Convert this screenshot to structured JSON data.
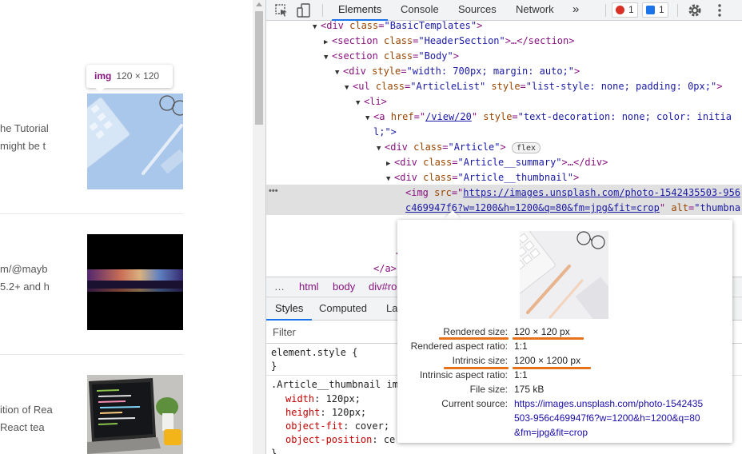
{
  "page": {
    "articles": [
      {
        "snippet_line1": "he Tutorial",
        "snippet_line2": " might be t"
      },
      {
        "snippet_line1": "m/@mayb",
        "snippet_line2": "5.2+ and h"
      },
      {
        "snippet_line1": "ition of Rea",
        "snippet_line2": " React tea"
      }
    ],
    "tooltip": {
      "tag": "img",
      "size": "120 × 120"
    }
  },
  "devtools": {
    "tabs": [
      {
        "label": "Elements",
        "active": true
      },
      {
        "label": "Console"
      },
      {
        "label": "Sources"
      },
      {
        "label": "Network"
      }
    ],
    "more_tabs": "»",
    "errors_count": "1",
    "messages_count": "1",
    "dom": {
      "l1_tag": "<div ",
      "l1_attr": "class",
      "l1_val": "\"BasicTemplates\"",
      "l1_end": ">",
      "l2_tag": "<section ",
      "l2_attr": "class",
      "l2_val": "\"HeaderSection\"",
      "l2_end": ">…</section>",
      "l3_tag": "<section ",
      "l3_attr": "class",
      "l3_val": "\"Body\"",
      "l3_end": ">",
      "l4_tag": "<div ",
      "l4_attr": "style",
      "l4_val": "\"width: 700px; margin: auto;\"",
      "l4_end": ">",
      "l5_tag": "<ul ",
      "l5_attr": "class",
      "l5_val": "\"ArticleList\"",
      "l5_attr2": "style",
      "l5_val2": "\"list-style: none; padding: 0px;\"",
      "l5_end": ">",
      "l6_tag": "<li>",
      "l7_tag": "<a ",
      "l7_attr": "href",
      "l7_link": "/view/20",
      "l7_attr2": "style",
      "l7_val2": "\"text-decoration: none; color: initia",
      "l7b": "l;\">",
      "l8_tag": "<div ",
      "l8_attr": "class",
      "l8_val": "\"Article\"",
      "l8_end": ">",
      "l8_badge": "flex",
      "l9_tag": "<div ",
      "l9_attr": "class",
      "l9_val": "\"Article__summary\"",
      "l9_end": ">…</div>",
      "l10_tag": "<div ",
      "l10_attr": "class",
      "l10_val": "\"Article__thumbnail\"",
      "l10_end": ">",
      "l11_tag": "<img ",
      "l11_attr": "src",
      "l11_link": "https://images.unsplash.com/photo-1542435503-956",
      "l11b_link": "c469947f6?w=1200&h=1200&q=80&fm=jpg&fit=crop",
      "l11b_attr": "alt",
      "l11b_val": "\"thumbna",
      "l12": "</",
      "l13": "</a>",
      "ellipsis": "•••"
    },
    "breadcrumbs": [
      "html",
      "body",
      "div#ro"
    ],
    "breadcrumb_dots": "…",
    "style_tabs": [
      {
        "label": "Styles",
        "active": true
      },
      {
        "label": "Computed"
      },
      {
        "label": "La"
      }
    ],
    "filter_placeholder": "Filter",
    "styles": {
      "element_style_selector": "element.style {",
      "close_brace": "}",
      "rule_selector": ".Article__thumbnail im",
      "props": [
        {
          "name": "width",
          "value": "120px;"
        },
        {
          "name": "height",
          "value": "120px;"
        },
        {
          "name": "object-fit",
          "value": "cover;"
        },
        {
          "name": "object-position",
          "value": "ce"
        }
      ],
      "last_brace": "}"
    }
  },
  "popover": {
    "rows": [
      {
        "key": "Rendered size:",
        "value": "120 × 120 px"
      },
      {
        "key": "Rendered aspect ratio:",
        "value": "1:1"
      },
      {
        "key": "Intrinsic size:",
        "value": "1200 × 1200 px"
      },
      {
        "key": "Intrinsic aspect ratio:",
        "value": "1:1"
      },
      {
        "key": "File size:",
        "value": "175 kB"
      },
      {
        "key": "Current source:",
        "value_line1": "https://images.unsplash.com/photo-1542435",
        "value_line2": "503-956c469947f6?w=1200&h=1200&q=80",
        "value_line3": "&fm=jpg&fit=crop"
      }
    ]
  },
  "colors": {
    "highlight_underline": "#e8721c",
    "accent": "#1a73e8",
    "error_badge": "#d93025",
    "message_badge": "#1a73e8"
  }
}
